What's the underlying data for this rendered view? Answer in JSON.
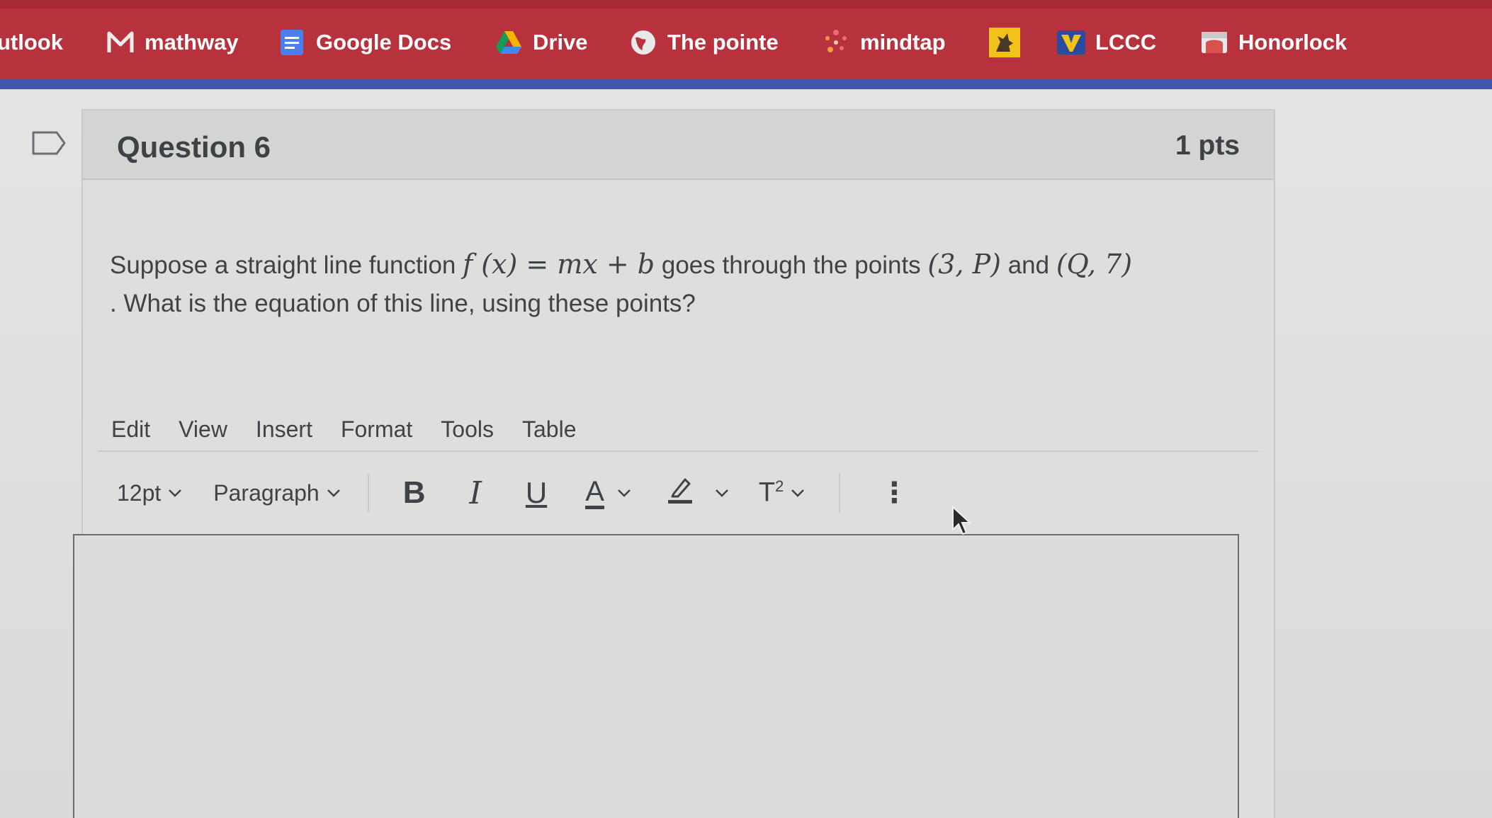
{
  "bookmarks": [
    {
      "label": "utlook",
      "icon": "none"
    },
    {
      "label": "mathway",
      "icon": "mathway-icon"
    },
    {
      "label": "Google Docs",
      "icon": "google-docs-icon"
    },
    {
      "label": "Drive",
      "icon": "google-drive-icon"
    },
    {
      "label": "The pointe",
      "icon": "globe-icon"
    },
    {
      "label": "mindtap",
      "icon": "mindtap-icon"
    },
    {
      "label": "",
      "icon": "cowboy-logo-icon"
    },
    {
      "label": "LCCC",
      "icon": "lccc-icon"
    },
    {
      "label": "Honorlock",
      "icon": "honorlock-icon"
    }
  ],
  "question": {
    "title": "Question 6",
    "points": "1 pts",
    "text_part1": "Suppose a straight line function ",
    "math_fx": "f (x) = mx + b",
    "text_part2": " goes through the points ",
    "math_p1": "(3, P)",
    "text_part3": " and ",
    "math_p2": "(Q, 7)",
    "text_line2": ". What is the equation of this line, using these points?"
  },
  "editor": {
    "menu": [
      "Edit",
      "View",
      "Insert",
      "Format",
      "Tools",
      "Table"
    ],
    "font_size": "12pt",
    "block_format": "Paragraph",
    "bold_label": "B",
    "italic_label": "I",
    "underline_label": "U",
    "text_color_label": "A",
    "superscript_label": "T",
    "superscript_exp": "2",
    "more_label": "⋮",
    "content": ""
  },
  "colors": {
    "bookmark_bar": "#b8323e",
    "accent_line": "#3f57a6",
    "text": "#3f4347"
  }
}
